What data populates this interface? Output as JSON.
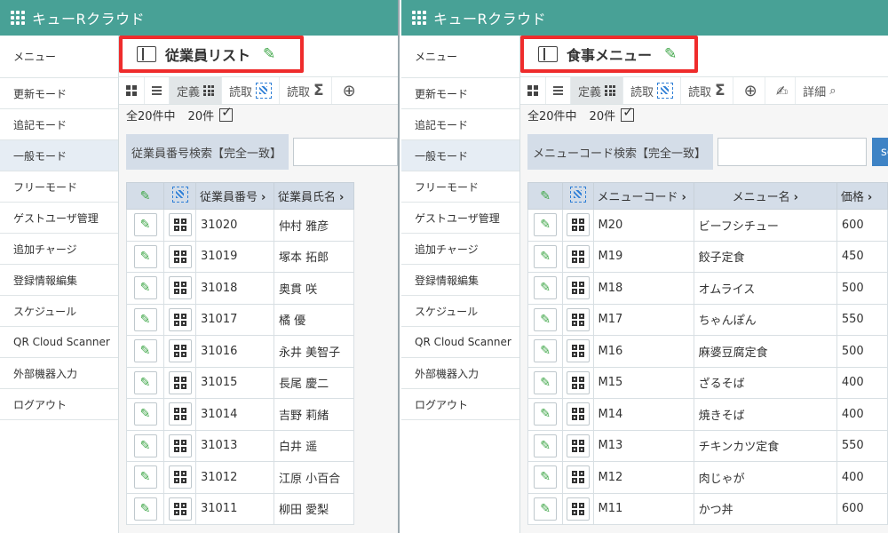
{
  "app": {
    "title": "キューRクラウド"
  },
  "sidebar": {
    "items": [
      {
        "label": "メニュー"
      },
      {
        "label": "更新モード"
      },
      {
        "label": "追記モード"
      },
      {
        "label": "一般モード"
      },
      {
        "label": "フリーモード"
      },
      {
        "label": "ゲストユーザ管理"
      },
      {
        "label": "追加チャージ"
      },
      {
        "label": "登録情報編集"
      },
      {
        "label": "スケジュール"
      },
      {
        "label": "QR Cloud Scanner"
      },
      {
        "label": "外部機器入力"
      },
      {
        "label": "ログアウト"
      }
    ],
    "active_index": 3
  },
  "toolbar": {
    "definition_label": "定義",
    "read_qr_label": "読取",
    "read_sum_label": "読取",
    "detail_label": "詳細",
    "sum_glyph": "Σ",
    "add_glyph": "⊕",
    "magnifier_glyph": "🔍"
  },
  "left": {
    "title": "従業員リスト",
    "count_total": "全20件中",
    "count_shown": "20件",
    "search_label": "従業員番号検索【完全一致】",
    "search_value": "",
    "columns": [
      "従業員番号",
      "従業員氏名"
    ],
    "rows": [
      [
        "31020",
        "仲村 雅彦"
      ],
      [
        "31019",
        "塚本 拓郎"
      ],
      [
        "31018",
        "奥貫 咲"
      ],
      [
        "31017",
        "橘 優"
      ],
      [
        "31016",
        "永井 美智子"
      ],
      [
        "31015",
        "長尾 慶二"
      ],
      [
        "31014",
        "吉野 莉緒"
      ],
      [
        "31013",
        "白井 遥"
      ],
      [
        "31012",
        "江原 小百合"
      ],
      [
        "31011",
        "柳田 愛梨"
      ]
    ]
  },
  "right": {
    "title": "食事メニュー",
    "count_total": "全20件中",
    "count_shown": "20件",
    "search_label": "メニューコード検索【完全一致】",
    "search_value": "",
    "search_button": "sea",
    "columns": [
      "メニューコード",
      "メニュー名",
      "価格"
    ],
    "rows": [
      [
        "M20",
        "ビーフシチュー",
        "600"
      ],
      [
        "M19",
        "餃子定食",
        "450"
      ],
      [
        "M18",
        "オムライス",
        "500"
      ],
      [
        "M17",
        "ちゃんぽん",
        "550"
      ],
      [
        "M16",
        "麻婆豆腐定食",
        "500"
      ],
      [
        "M15",
        "ざるそば",
        "400"
      ],
      [
        "M14",
        "焼きそば",
        "400"
      ],
      [
        "M13",
        "チキンカツ定食",
        "550"
      ],
      [
        "M12",
        "肉じゃが",
        "400"
      ],
      [
        "M11",
        "かつ丼",
        "600"
      ]
    ]
  },
  "colors": {
    "header": "#48a196",
    "highlight": "#ef2c2c",
    "pencil": "#3fa648",
    "table_header": "#d4dde8",
    "search_button": "#3e83c5"
  }
}
